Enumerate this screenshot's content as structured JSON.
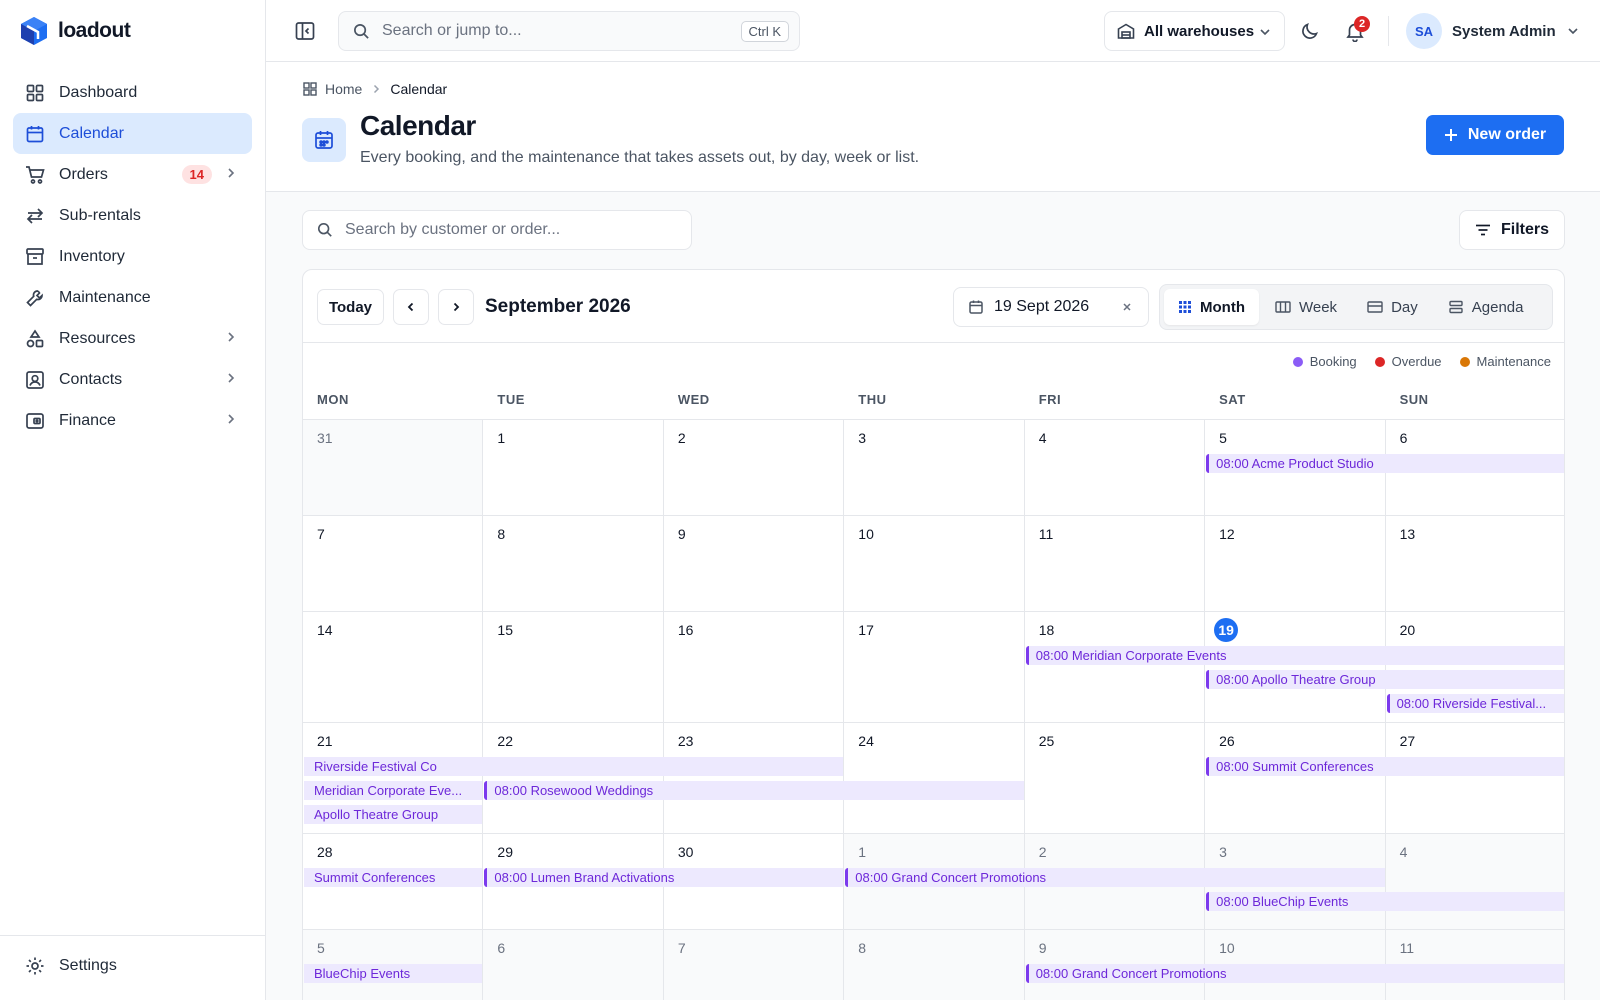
{
  "app": {
    "name": "loadout"
  },
  "sidebar": {
    "items": [
      {
        "label": "Dashboard",
        "icon": "grid-icon"
      },
      {
        "label": "Calendar",
        "icon": "calendar-icon",
        "active": true
      },
      {
        "label": "Orders",
        "icon": "cart-icon",
        "badge": "14",
        "chevron": true
      },
      {
        "label": "Sub-rentals",
        "icon": "arrows-icon"
      },
      {
        "label": "Inventory",
        "icon": "box-icon"
      },
      {
        "label": "Maintenance",
        "icon": "wrench-icon"
      },
      {
        "label": "Resources",
        "icon": "shapes-icon",
        "chevron": true
      },
      {
        "label": "Contacts",
        "icon": "contact-card-icon",
        "chevron": true
      },
      {
        "label": "Finance",
        "icon": "wallet-icon",
        "chevron": true
      }
    ],
    "settings_label": "Settings"
  },
  "topbar": {
    "search_placeholder": "Search or jump to...",
    "shortcut": "Ctrl K",
    "warehouse": "All warehouses",
    "notifications_count": "2",
    "user_initials": "SA",
    "user_name": "System Admin"
  },
  "breadcrumb": {
    "home": "Home",
    "current": "Calendar"
  },
  "page": {
    "title": "Calendar",
    "subtitle": "Every booking, and the maintenance that takes assets out, by day, week or list.",
    "new_order_label": "New order"
  },
  "filters": {
    "search_placeholder": "Search by customer or order...",
    "filters_label": "Filters"
  },
  "calendar": {
    "today_label": "Today",
    "month_label": "September 2026",
    "selected_date": "19 Sept 2026",
    "views": [
      "Month",
      "Week",
      "Day",
      "Agenda"
    ],
    "active_view": "Month",
    "legend": [
      {
        "label": "Booking",
        "color": "#8b5cf6"
      },
      {
        "label": "Overdue",
        "color": "#dc2626"
      },
      {
        "label": "Maintenance",
        "color": "#d97706"
      }
    ],
    "weekdays": [
      "MON",
      "TUE",
      "WED",
      "THU",
      "FRI",
      "SAT",
      "SUN"
    ],
    "weeks": [
      {
        "days": [
          "31",
          "1",
          "2",
          "3",
          "4",
          "5",
          "6"
        ],
        "out": [
          0
        ]
      },
      {
        "days": [
          "7",
          "8",
          "9",
          "10",
          "11",
          "12",
          "13"
        ],
        "out": []
      },
      {
        "days": [
          "14",
          "15",
          "16",
          "17",
          "18",
          "19",
          "20"
        ],
        "out": [],
        "today": 5
      },
      {
        "days": [
          "21",
          "22",
          "23",
          "24",
          "25",
          "26",
          "27"
        ],
        "out": []
      },
      {
        "days": [
          "28",
          "29",
          "30",
          "1",
          "2",
          "3",
          "4"
        ],
        "out": [
          3,
          4,
          5,
          6
        ]
      },
      {
        "days": [
          "5",
          "6",
          "7",
          "8",
          "9",
          "10",
          "11"
        ],
        "out": [
          0,
          1,
          2,
          3,
          4,
          5,
          6
        ]
      }
    ],
    "events": [
      {
        "week": 0,
        "start": 5,
        "span": 2,
        "lane": 0,
        "label": "08:00 Acme Product Studio",
        "is_start": true
      },
      {
        "week": 2,
        "start": 4,
        "span": 3,
        "lane": 0,
        "label": "08:00 Meridian Corporate Events",
        "is_start": true
      },
      {
        "week": 2,
        "start": 5,
        "span": 2,
        "lane": 1,
        "label": "08:00 Apollo Theatre Group",
        "is_start": true
      },
      {
        "week": 2,
        "start": 6,
        "span": 1,
        "lane": 2,
        "label": "08:00 Riverside Festival...",
        "is_start": true
      },
      {
        "week": 3,
        "start": 0,
        "span": 3,
        "lane": 0,
        "label": "Riverside Festival Co",
        "is_start": false
      },
      {
        "week": 3,
        "start": 0,
        "span": 1,
        "lane": 1,
        "label": "Meridian Corporate Eve...",
        "is_start": false
      },
      {
        "week": 3,
        "start": 1,
        "span": 3,
        "lane": 1,
        "label": "08:00 Rosewood Weddings",
        "is_start": true
      },
      {
        "week": 3,
        "start": 0,
        "span": 1,
        "lane": 2,
        "label": "Apollo Theatre Group",
        "is_start": false
      },
      {
        "week": 3,
        "start": 5,
        "span": 2,
        "lane": 0,
        "label": "08:00 Summit Conferences",
        "is_start": true
      },
      {
        "week": 4,
        "start": 0,
        "span": 1,
        "lane": 0,
        "label": "Summit Conferences",
        "is_start": false
      },
      {
        "week": 4,
        "start": 1,
        "span": 2,
        "lane": 0,
        "label": "08:00 Lumen Brand Activations",
        "is_start": true
      },
      {
        "week": 4,
        "start": 3,
        "span": 3,
        "lane": 0,
        "label": "08:00 Grand Concert Promotions",
        "is_start": true
      },
      {
        "week": 4,
        "start": 5,
        "span": 2,
        "lane": 1,
        "label": "08:00 BlueChip Events",
        "is_start": true
      },
      {
        "week": 5,
        "start": 0,
        "span": 1,
        "lane": 0,
        "label": "BlueChip Events",
        "is_start": false
      },
      {
        "week": 5,
        "start": 4,
        "span": 3,
        "lane": 0,
        "label": "08:00 Grand Concert Promotions",
        "is_start": true
      }
    ]
  }
}
